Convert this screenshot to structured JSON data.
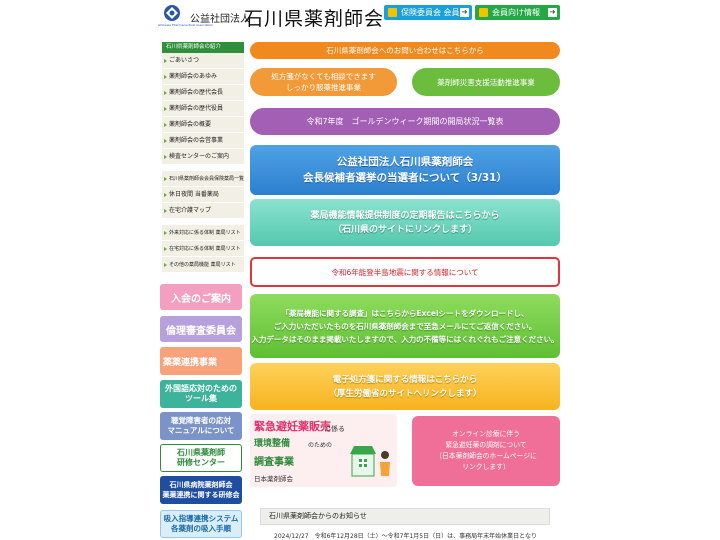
{
  "header": {
    "logo_subtext": "Ishikawa Pharmaceutical Association",
    "org_type": "公益社団法人",
    "org_name": "石川県薬剤師会",
    "btn_insurance": "保険委員会 会員用",
    "btn_members": "会員向け情報"
  },
  "sidebar": {
    "heading": "石川県薬剤師会の紹介",
    "group1": [
      "ごあいさつ",
      "薬剤師会のあゆみ",
      "薬剤師会の歴代会長",
      "薬剤師会の歴代役員",
      "薬剤師会の概要",
      "薬剤師会の会営事業",
      "検査センターのご案内"
    ],
    "group2": [
      "石川県薬剤師会会員保険薬局一覧",
      "休日夜間 当番薬局",
      "在宅介護マップ"
    ],
    "group3": [
      "外来対応に係る体制 薬局リスト",
      "在宅対応に係る体制 薬局リスト",
      "その他の薬局機能 薬局リスト"
    ]
  },
  "banners": {
    "join": "入会のご案内",
    "ethics": "倫理審査委員会",
    "coop": "薬薬連携事業",
    "tools_line1": "外国語応対のための",
    "tools_line2": "ツール集",
    "hearing_line1": "聴覚障害者の応対",
    "hearing_line2": "マニュアルについて",
    "center_line1": "石川県薬剤師",
    "center_line2": "研修センター",
    "hospital_line1": "石川県病院薬剤師会",
    "hospital_line2": "薬薬連携に関する研修会",
    "inhaler_line1": "吸入指導連携システム",
    "inhaler_line2": "各薬剤の吸入手順"
  },
  "main": {
    "contact": "石川県薬剤師会へのお問い合わせはこちらから",
    "consult_line1": "処方箋がなくても相談できます",
    "consult_line2": "しっかり服薬推進事業",
    "disaster": "薬剤師災害支援活動推進事業",
    "golden": "令和7年度　ゴールデンウィーク期間の開局状況一覧表",
    "election_line1": "公益社団法人石川県薬剤師会",
    "election_line2": "会長候補者選挙の当選者について（3/31）",
    "report_line1": "薬局機能情報提供制度の定期報告はこちらから",
    "report_line2": "（石川県のサイトにリンクします）",
    "quake": "令和6年能登半島地震に関する情報について",
    "survey_line1": "「薬局機能に関する調査」はこちらからExcelシートをダウンロードし、",
    "survey_line2": "ご入力いただいたものを石川県薬剤師会まで至急メールにてご返信ください。",
    "survey_line3": "入力データはそのまま掲載いたしますので、入力の不備等にはくれぐれもご注意ください。",
    "eprescr_line1": "電子処方箋に関する情報はこちらから",
    "eprescr_line2": "（厚生労働省のサイトへリンクします）",
    "emerg_t1": "緊急避妊薬販売",
    "emerg_t2": "に係る",
    "emerg_t3": "環境整備",
    "emerg_t4": "のための",
    "emerg_t5": "調査事業",
    "emerg_t6": "日本薬剤師会",
    "online_line1": "オンライン診療に伴う",
    "online_line2": "緊急避妊薬の調剤について",
    "online_line3": "（日本薬剤師会のホームページに",
    "online_line4": "リンクします）"
  },
  "news": {
    "heading": "石川県薬剤師会からのお知らせ",
    "item1": "2024/12/27　令和6年12月28日（土）～令和7年1月5日（日）は、事務局年末年始休業日となり"
  },
  "colors": {
    "orange": "#f08a1e",
    "green": "#6cbd3e",
    "purple": "#a25fb4",
    "blue": "#2c7fcf",
    "red": "#e0353b",
    "pink": "#ef6f99"
  }
}
